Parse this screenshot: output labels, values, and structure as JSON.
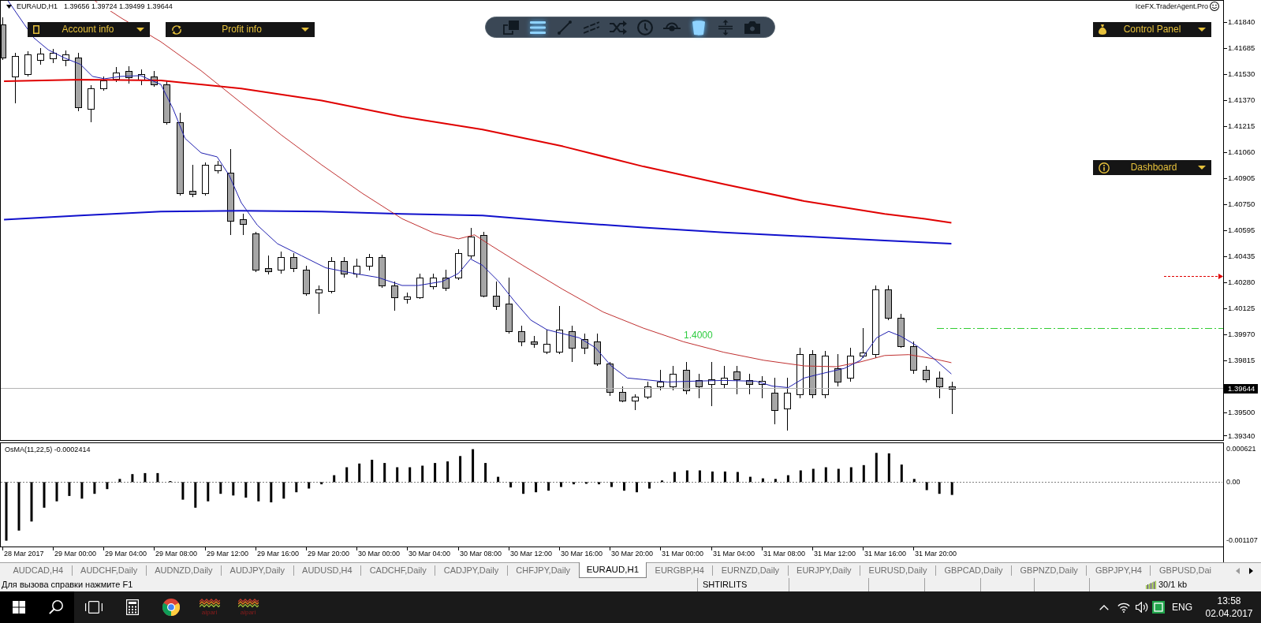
{
  "chart": {
    "symbol": "EURAUD,H1",
    "ohlc": "1.39656 1.39724 1.39499 1.39644",
    "expert": "IceFX.TraderAgent.Pro"
  },
  "panels": [
    {
      "kind": "account",
      "label": "Account info"
    },
    {
      "kind": "profit",
      "label": "Profit info"
    },
    {
      "kind": "control",
      "label": "Control Panel"
    },
    {
      "kind": "dashboard",
      "label": "Dashboard"
    }
  ],
  "toolbar": [
    {
      "kind": "windows",
      "active": false
    },
    {
      "kind": "menu",
      "active": true
    },
    {
      "kind": "line",
      "active": false
    },
    {
      "kind": "channel",
      "active": false
    },
    {
      "kind": "shuffle",
      "active": false
    },
    {
      "kind": "clock",
      "active": false
    },
    {
      "kind": "eye",
      "active": false
    },
    {
      "kind": "trash",
      "active": true
    },
    {
      "kind": "spacing",
      "active": false
    },
    {
      "kind": "camera",
      "active": false
    }
  ],
  "level_line": {
    "label": "1.4000"
  },
  "price_axis": {
    "labels": [
      "1.41840",
      "1.41685",
      "1.41530",
      "1.41370",
      "1.41215",
      "1.41060",
      "1.40905",
      "1.40750",
      "1.40595",
      "1.40435",
      "1.40280",
      "1.40125",
      "1.39970",
      "1.39815",
      "1.39500",
      "1.39340"
    ],
    "bid_label": "1.39644"
  },
  "indicator": {
    "chart_data": {
      "type": "bar",
      "title": "OsMA(11,22,5) -0.0002414",
      "categories": [
        null,
        null,
        null,
        null,
        null,
        null,
        null,
        null,
        null,
        null,
        null,
        null,
        null,
        null,
        null,
        null,
        null,
        null,
        null,
        null,
        null,
        null,
        null,
        null,
        null,
        null,
        null,
        null,
        null,
        null,
        null,
        null,
        null,
        null,
        null,
        null,
        null,
        null,
        null,
        null,
        null,
        null,
        null,
        null,
        null,
        null,
        null,
        null,
        null,
        null,
        null,
        null,
        null,
        null,
        null,
        null,
        null,
        null,
        null,
        null,
        null,
        null,
        null,
        null,
        null,
        null,
        null,
        null,
        null,
        null,
        null,
        null,
        null,
        null,
        null,
        null,
        null,
        null,
        null,
        null,
        null,
        null,
        null,
        null,
        null,
        null,
        null,
        null,
        null,
        null,
        null,
        null,
        null,
        null,
        null,
        null,
        null
      ],
      "values": [
        -0.0011,
        -0.00091,
        -0.00074,
        -0.00048,
        -0.00036,
        -0.00026,
        -0.00031,
        -0.00022,
        -0.00013,
        6e-05,
        0.00015,
        0.00017,
        0.00017,
        2e-05,
        -0.00033,
        -0.00048,
        -0.00036,
        -0.00022,
        -0.00025,
        -0.00029,
        -0.00036,
        -0.00038,
        -0.00031,
        -0.00019,
        -0.00012,
        -4e-05,
        0.00013,
        0.00028,
        0.00035,
        0.00042,
        0.00036,
        0.00028,
        0.00028,
        0.00031,
        0.00036,
        0.00039,
        0.00049,
        0.00062,
        0.00036,
        0.0001,
        -0.0001,
        -0.00022,
        -0.00019,
        -0.00016,
        -9e-05,
        -4e-05,
        -3e-05,
        -4e-05,
        -9e-05,
        -0.00016,
        -0.00019,
        -0.00012,
        3e-05,
        0.00019,
        0.00022,
        0.00022,
        0.0002,
        0.0002,
        0.00019,
        0.0001,
        7e-05,
        6e-05,
        0.00013,
        0.00022,
        0.00025,
        0.00028,
        0.00025,
        0.00028,
        0.00032,
        0.00055,
        0.00054,
        0.00033,
        6e-05,
        -0.00015,
        -0.00022,
        -0.00024,
        null,
        null,
        null,
        null,
        null,
        null,
        null,
        null,
        null,
        null,
        null,
        null,
        null,
        null,
        null,
        null,
        null,
        null,
        null,
        null,
        null
      ],
      "ylim": [
        -0.001211,
        0.000732
      ],
      "yticks": [
        {
          "value": 0.000621,
          "label": "0.000621"
        },
        {
          "value": 0,
          "label": "0.00"
        },
        {
          "value": -0.001107,
          "label": "-0.001107"
        }
      ]
    }
  },
  "time_axis": {
    "labels": [
      "28 Mar 2017",
      "29 Mar 00:00",
      "29 Mar 04:00",
      "29 Mar 08:00",
      "29 Mar 12:00",
      "29 Mar 16:00",
      "29 Mar 20:00",
      "30 Mar 00:00",
      "30 Mar 04:00",
      "30 Mar 08:00",
      "30 Mar 12:00",
      "30 Mar 16:00",
      "30 Mar 20:00",
      "31 Mar 00:00",
      "31 Mar 04:00",
      "31 Mar 08:00",
      "31 Mar 12:00",
      "31 Mar 16:00",
      "31 Mar 20:00"
    ]
  },
  "tabs": [
    {
      "label": "AUDCAD,H4",
      "selected": false
    },
    {
      "label": "AUDCHF,Daily",
      "selected": false
    },
    {
      "label": "AUDNZD,Daily",
      "selected": false
    },
    {
      "label": "AUDJPY,Daily",
      "selected": false
    },
    {
      "label": "AUDUSD,H4",
      "selected": false
    },
    {
      "label": "CADCHF,Daily",
      "selected": false
    },
    {
      "label": "CADJPY,Daily",
      "selected": false
    },
    {
      "label": "CHFJPY,Daily",
      "selected": false
    },
    {
      "label": "EURAUD,H1",
      "selected": true
    },
    {
      "label": "EURGBP,H4",
      "selected": false
    },
    {
      "label": "EURNZD,Daily",
      "selected": false
    },
    {
      "label": "EURJPY,Daily",
      "selected": false
    },
    {
      "label": "EURUSD,Daily",
      "selected": false
    },
    {
      "label": "GBPCAD,Daily",
      "selected": false
    },
    {
      "label": "GBPNZD,Daily",
      "selected": false
    },
    {
      "label": "GBPJPY,H4",
      "selected": false
    },
    {
      "label": "GBPUSD,Dai",
      "selected": false
    }
  ],
  "status_bar": {
    "hint": "Для вызова справки нажмите F1",
    "profile": "SHTIRLITS",
    "traffic": "30/1 kb"
  },
  "taskbar": {
    "apps": [
      {
        "kind": "calculator"
      },
      {
        "kind": "browser"
      },
      {
        "kind": "alpari",
        "label": "alpari"
      },
      {
        "kind": "alpari",
        "label": "alpari"
      }
    ],
    "language": "ENG",
    "time": "13:58",
    "date": "02.04.2017"
  }
}
